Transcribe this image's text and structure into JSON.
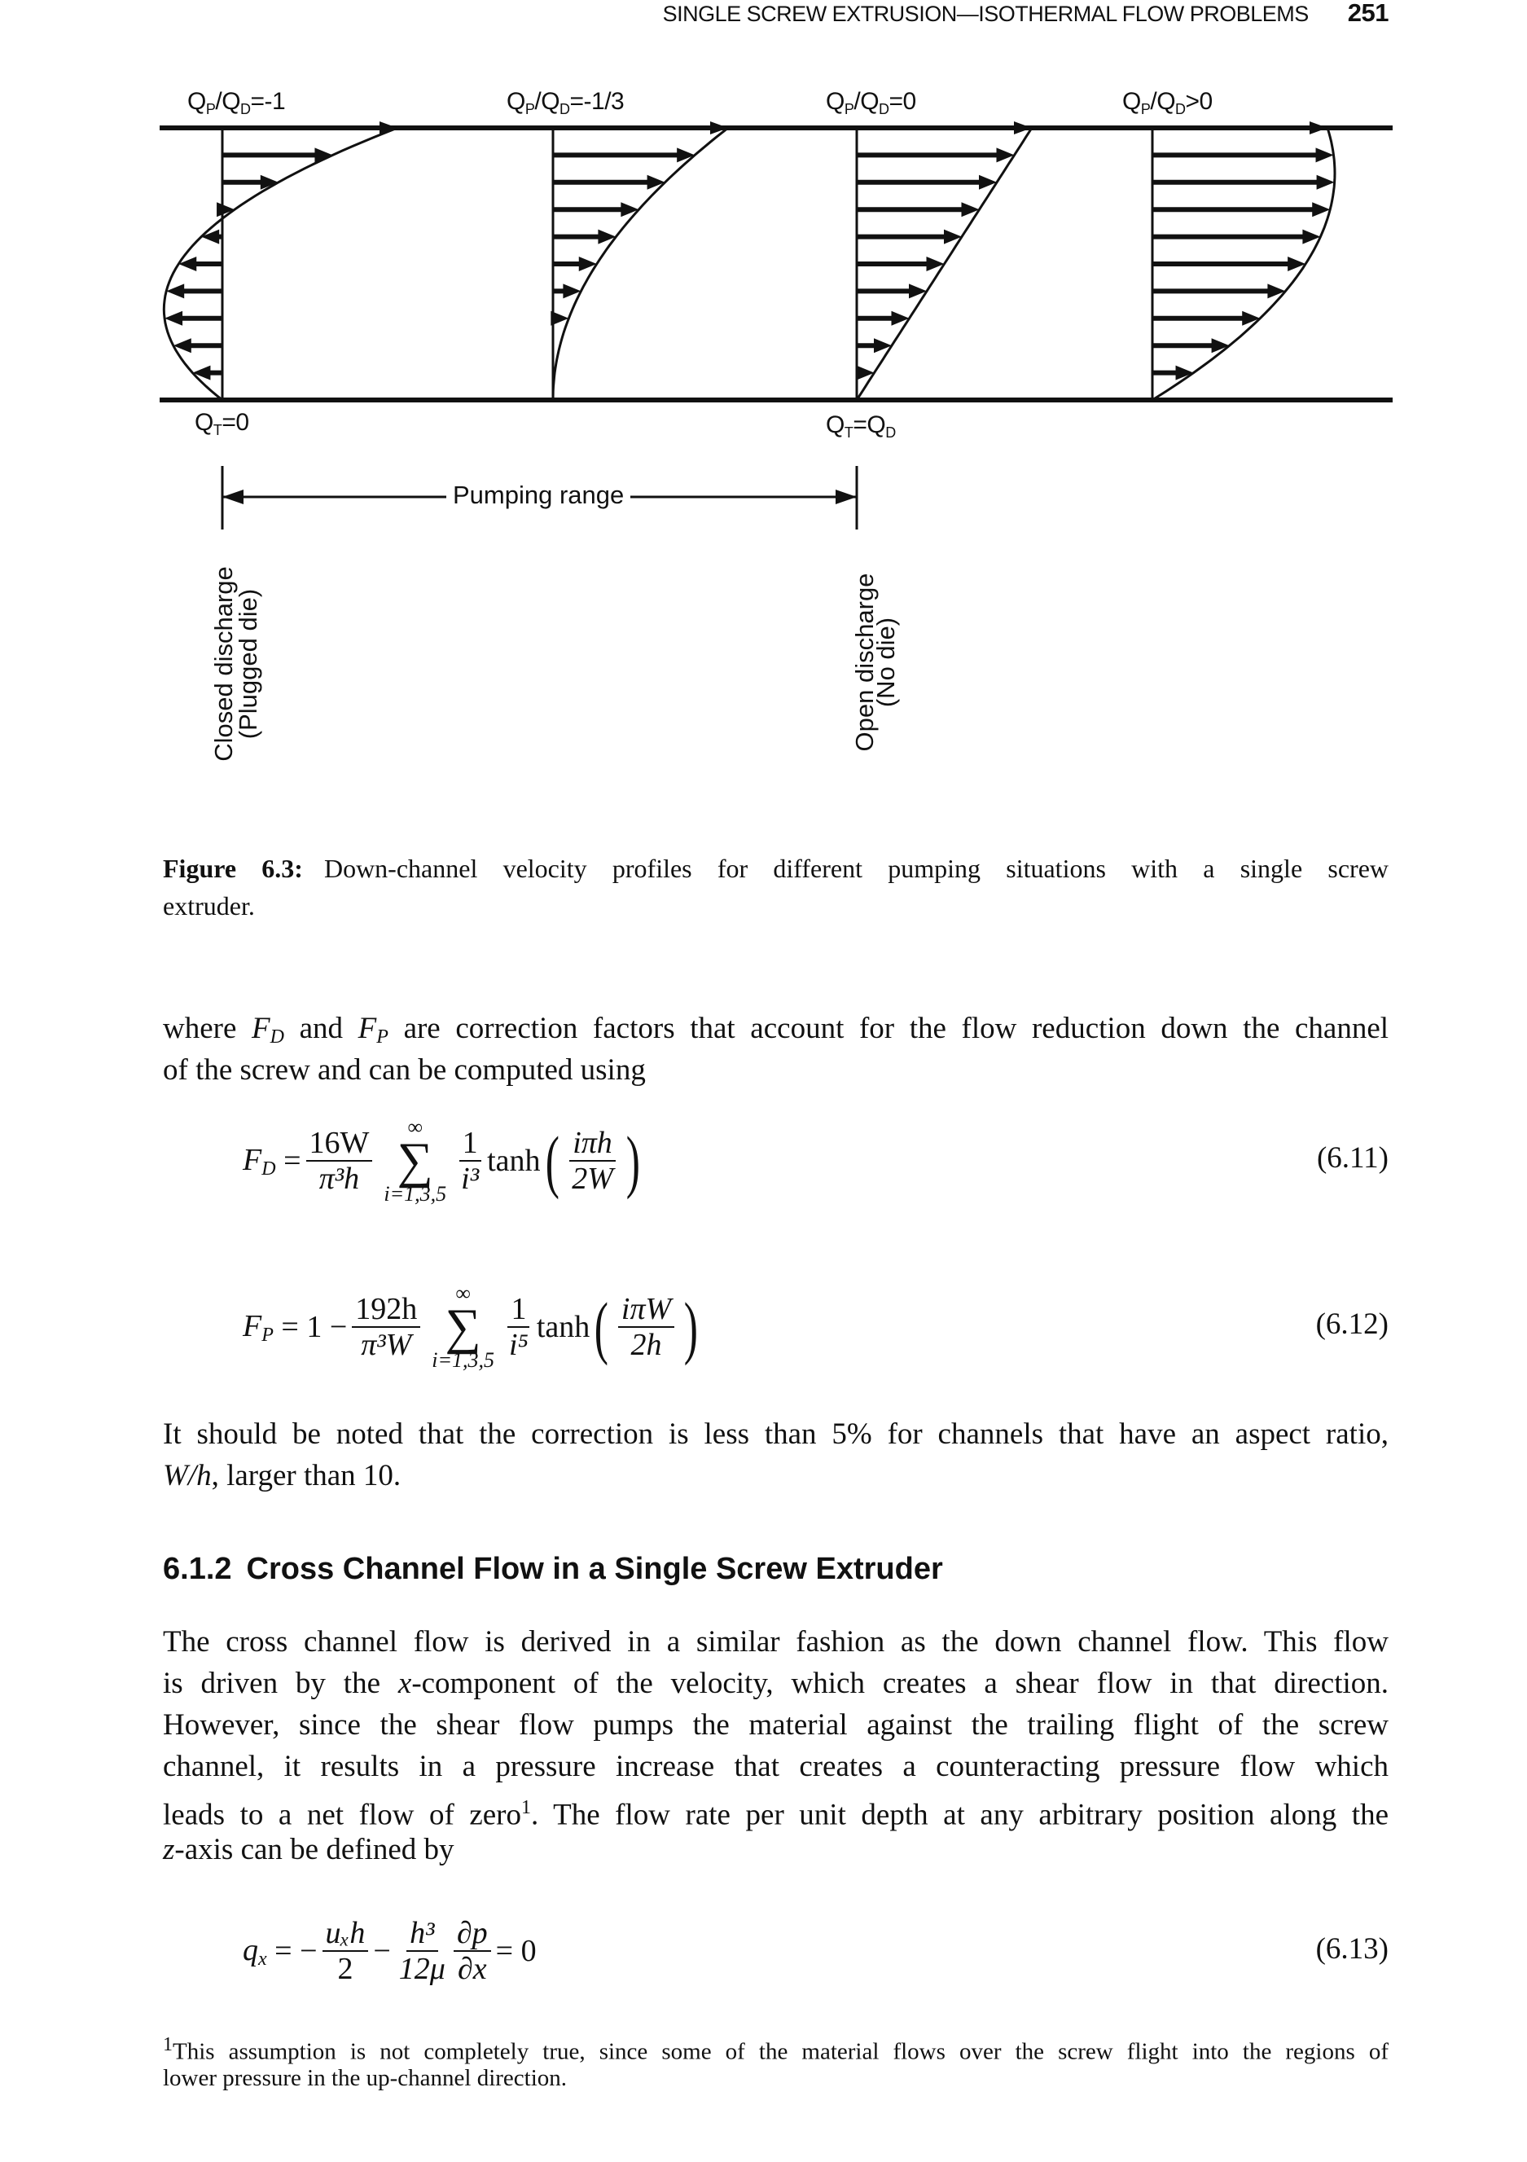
{
  "header": {
    "running_title": "SINGLE SCREW EXTRUSION—ISOTHERMAL FLOW PROBLEMS",
    "page_number": "251"
  },
  "figure": {
    "profile_labels": [
      {
        "q": "Q",
        "p": "P",
        "slash": "/Q",
        "d": "D",
        "rel": "=-1"
      },
      {
        "q": "Q",
        "p": "P",
        "slash": "/Q",
        "d": "D",
        "rel": "=-1/3"
      },
      {
        "q": "Q",
        "p": "P",
        "slash": "/Q",
        "d": "D",
        "rel": "=0"
      },
      {
        "q": "Q",
        "p": "P",
        "slash": "/Q",
        "d": "D",
        "rel": ">0"
      }
    ],
    "qt_zero": {
      "q": "Q",
      "t": "T",
      "rel": "=0"
    },
    "qt_qd": {
      "q": "Q",
      "t": "T",
      "rel": "=Q",
      "d": "D"
    },
    "pumping_range": "Pumping range",
    "closed": [
      "Closed discharge",
      "(Plugged die)"
    ],
    "open": [
      "Open discharge",
      "(No die)"
    ]
  },
  "caption": {
    "label": "Figure 6.3:",
    "lines": [
      "Down-channel velocity profiles for different pumping situations with a single screw",
      "extruder."
    ]
  },
  "para1": {
    "l1a": "where",
    "fd": "F",
    "fd_sub": "D",
    "l1b": "and",
    "fp": "F",
    "fp_sub": "P",
    "l1c": "are correction factors that account for the flow reduction down the channel",
    "l2": "of the screw and can be computed using"
  },
  "eq611": {
    "lhs": "F",
    "lhs_sub": "D",
    "eq": "=",
    "num": "16W",
    "den": "π³h",
    "sum_top": "∞",
    "sum_sym": "∑",
    "sum_bot": "i=1,3,5",
    "inum": "1",
    "iden": "i³",
    "fn": "tanh",
    "anum": "iπh",
    "aden": "2W",
    "number": "(6.11)"
  },
  "eq612": {
    "lhs": "F",
    "lhs_sub": "P",
    "eq": "= 1 −",
    "num": "192h",
    "den": "π³W",
    "sum_top": "∞",
    "sum_sym": "∑",
    "sum_bot": "i=1,3,5",
    "inum": "1",
    "iden": "i⁵",
    "fn": "tanh",
    "anum": "iπW",
    "aden": "2h",
    "number": "(6.12)"
  },
  "para2": {
    "l1": "It should be noted that the correction is less than 5% for channels that have an aspect ratio,",
    "wh": "W/h",
    "l2": ", larger than 10."
  },
  "section": {
    "number": "6.1.2",
    "title": "Cross Channel Flow in a Single Screw Extruder"
  },
  "para3": {
    "l1": "The cross channel flow is derived in a similar fashion as the down channel flow. This flow",
    "l2a": "is driven by the",
    "x": "x",
    "l2b": "-component of the velocity, which creates a shear flow in that direction.",
    "l3": "However, since the shear flow pumps the material against the trailing flight of the screw",
    "l4": "channel, it results in a pressure increase that creates a counteracting pressure flow which",
    "l5a": "leads to a net flow of zero",
    "fn": "1",
    "l5b": ". The flow rate per unit depth at any arbitrary position along the",
    "z": "z",
    "l6": "-axis can be defined by"
  },
  "eq613": {
    "lhs": "q",
    "lhs_sub": "x",
    "eq": "= −",
    "n1": "uₓh",
    "d1": "2",
    "minus": "−",
    "n2": "h³",
    "d2": "12μ",
    "n3": "∂p",
    "d3": "∂x",
    "rhs": "= 0",
    "number": "(6.13)"
  },
  "footnote": {
    "mark": "1",
    "l1": "This assumption is not completely true, since some of the material flows over the screw flight into the regions of",
    "l2": "lower pressure in the up-channel direction."
  }
}
